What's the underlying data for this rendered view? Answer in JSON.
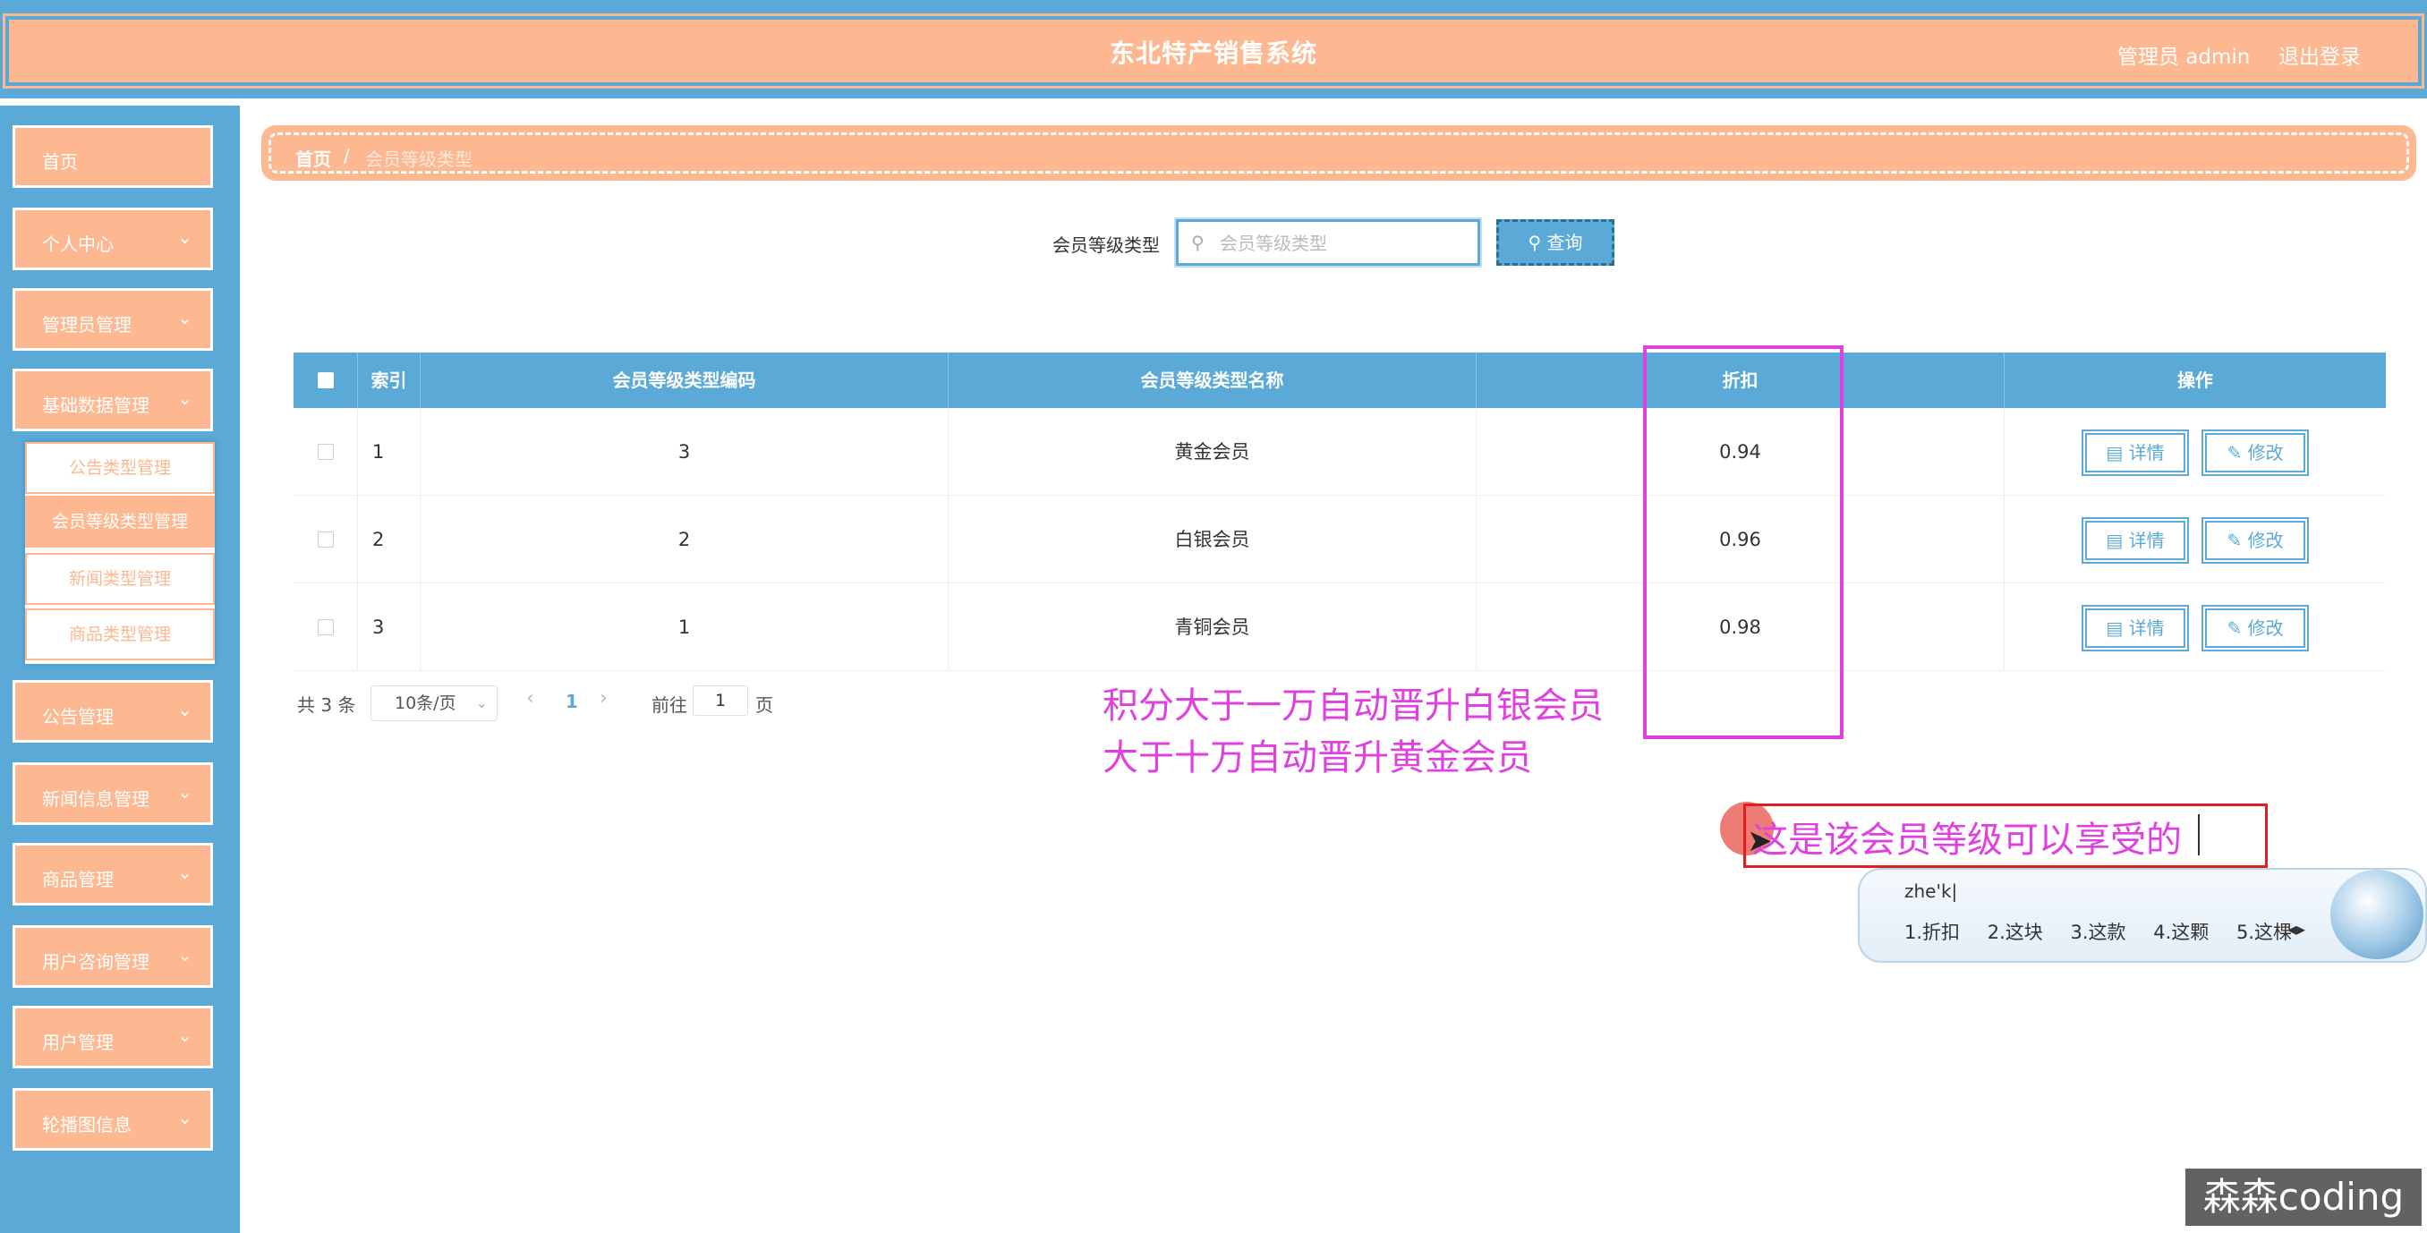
{
  "header": {
    "title": "东北特产销售系统",
    "user": "管理员 admin",
    "logout": "退出登录"
  },
  "sidebar": {
    "items": [
      {
        "label": "首页"
      },
      {
        "label": "个人中心"
      },
      {
        "label": "管理员管理"
      },
      {
        "label": "基础数据管理"
      },
      {
        "label": "公告管理"
      },
      {
        "label": "新闻信息管理"
      },
      {
        "label": "商品管理"
      },
      {
        "label": "用户咨询管理"
      },
      {
        "label": "用户管理"
      },
      {
        "label": "轮播图信息"
      }
    ],
    "submenu": [
      {
        "label": "公告类型管理"
      },
      {
        "label": "会员等级类型管理"
      },
      {
        "label": "新闻类型管理"
      },
      {
        "label": "商品类型管理"
      }
    ]
  },
  "breadcrumb": {
    "home": "首页",
    "sep": "/",
    "current": "会员等级类型"
  },
  "search": {
    "label": "会员等级类型",
    "placeholder": "会员等级类型",
    "button": "查询"
  },
  "table": {
    "columns": [
      "索引",
      "会员等级类型编码",
      "会员等级类型名称",
      "折扣",
      "操作"
    ],
    "rows": [
      {
        "index": "1",
        "code": "3",
        "name": "黄金会员",
        "discount": "0.94"
      },
      {
        "index": "2",
        "code": "2",
        "name": "白银会员",
        "discount": "0.96"
      },
      {
        "index": "3",
        "code": "1",
        "name": "青铜会员",
        "discount": "0.98"
      }
    ],
    "detail_label": "详情",
    "edit_label": "修改"
  },
  "pagination": {
    "total": "共 3 条",
    "page_size": "10条/页",
    "current_page": "1",
    "goto_label": "前往",
    "goto_value": "1",
    "page_label": "页"
  },
  "annotations": {
    "note_line1": "积分大于一万自动晋升白银会员",
    "note_line2": "大于十万自动晋升黄金会员",
    "typing": "这是该会员等级可以享受的"
  },
  "ime": {
    "code": "zhe'k|",
    "candidates": [
      "1.折扣",
      "2.这块",
      "3.这款",
      "4.这颗",
      "5.这棵"
    ]
  },
  "watermark": "森森coding",
  "colors": {
    "accent_blue": "#5aa9d6",
    "accent_peach": "#fdb891",
    "annotation_magenta": "#e040e0",
    "annotation_red": "#e02020"
  },
  "icons": {
    "search": "search-icon",
    "detail": "document-icon",
    "edit": "pencil-icon",
    "chevron": "chevron-down-icon"
  }
}
